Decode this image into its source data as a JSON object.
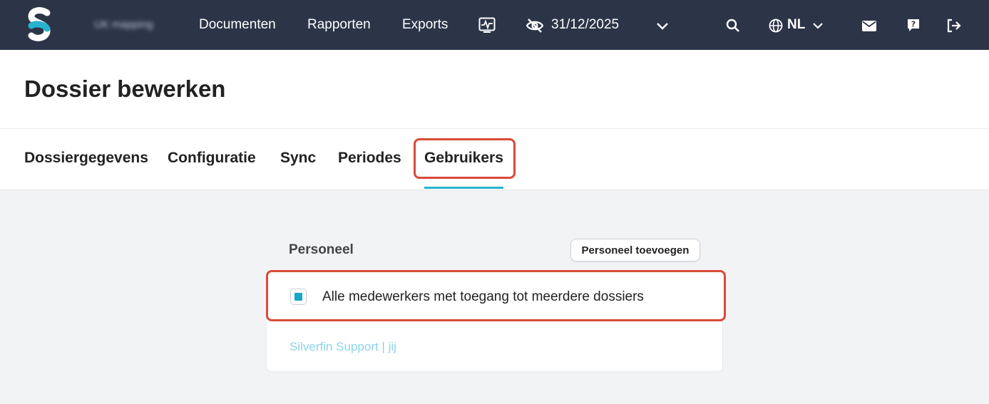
{
  "topbar": {
    "org_name": "UK mapping",
    "nav": [
      "Documenten",
      "Rapporten",
      "Exports"
    ],
    "date": "31/12/2025",
    "language": "NL"
  },
  "page": {
    "title": "Dossier bewerken"
  },
  "tabs": [
    {
      "label": "Dossiergegevens"
    },
    {
      "label": "Configuratie"
    },
    {
      "label": "Sync"
    },
    {
      "label": "Periodes"
    },
    {
      "label": "Gebruikers",
      "active": true
    }
  ],
  "personnel": {
    "title": "Personeel",
    "add_button": "Personeel toevoegen",
    "all_employees_label": "Alle medewerkers met toegang tot meerdere dossiers",
    "user_entry": "Silverfin Support | jij"
  },
  "colors": {
    "topbar": "#2c3548",
    "accent": "#27b3cf",
    "highlight": "#d94a3a"
  }
}
